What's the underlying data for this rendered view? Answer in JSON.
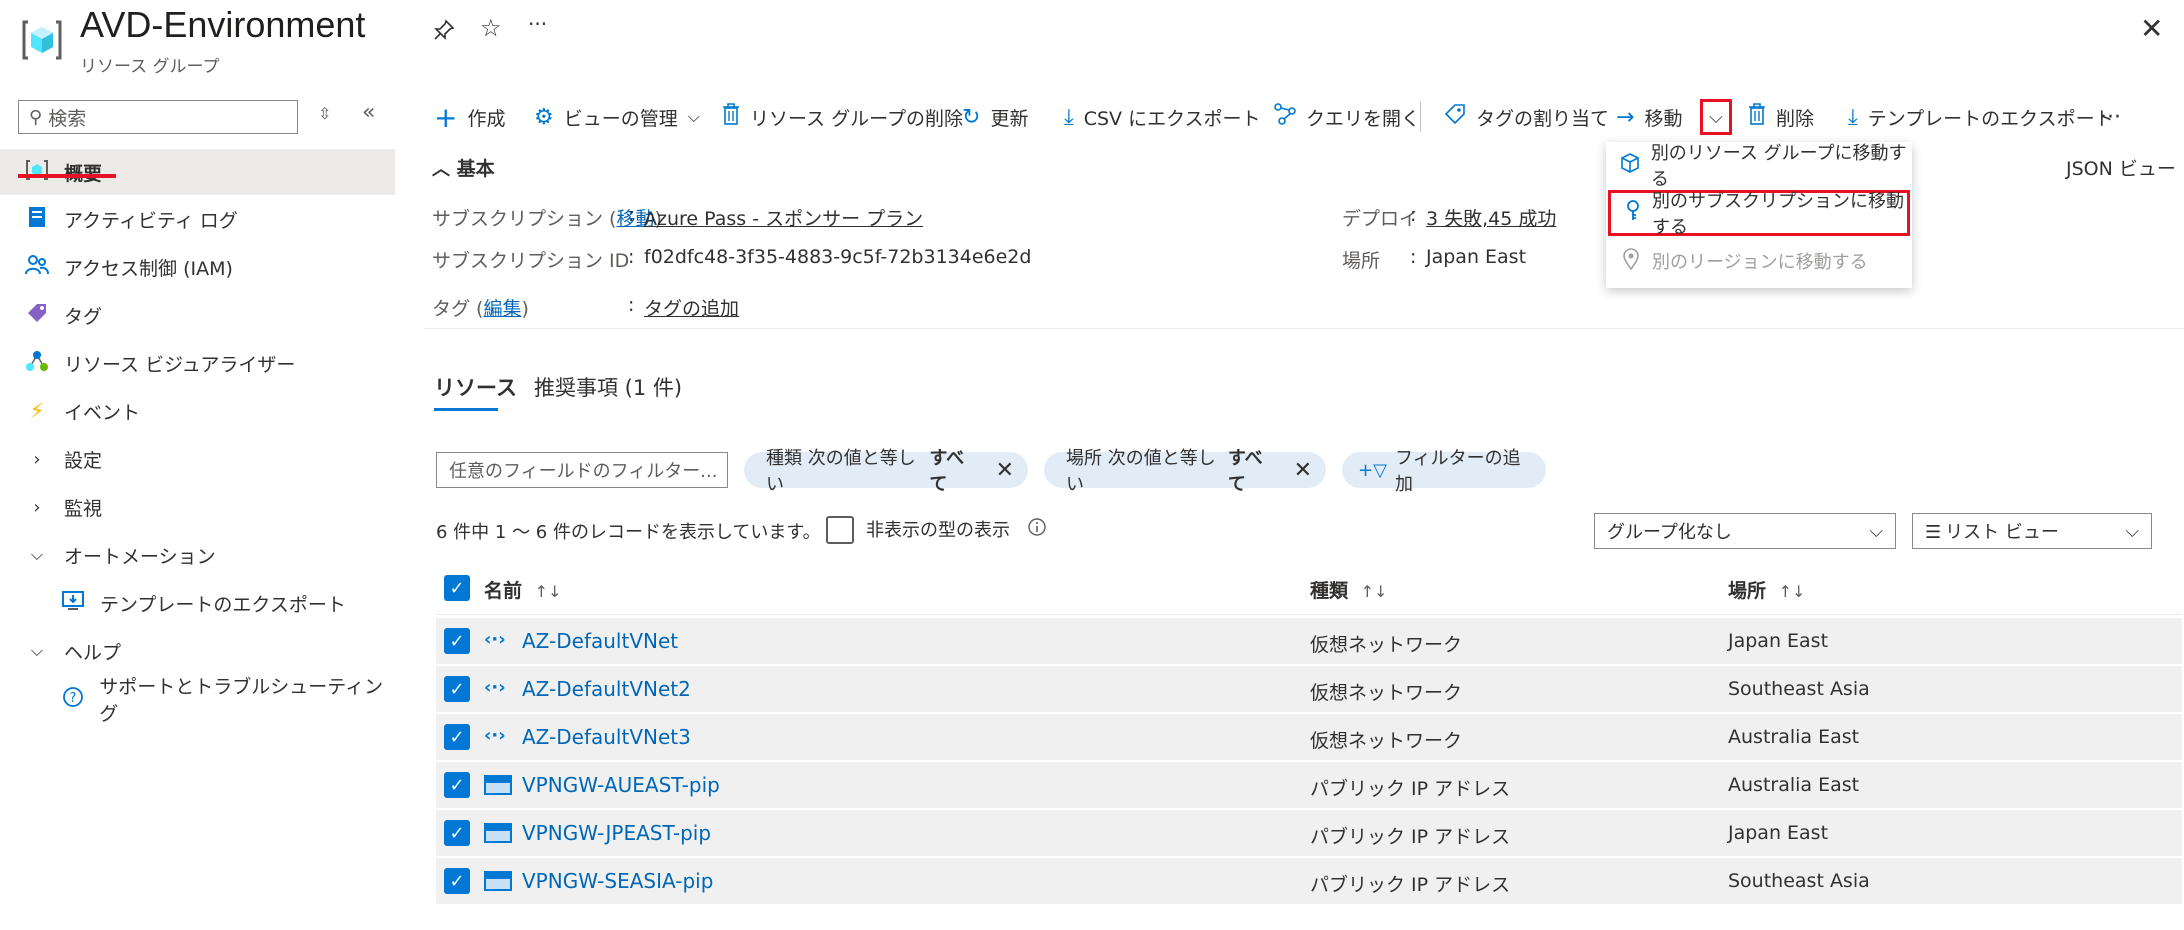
{
  "header": {
    "title": "AVD-Environment",
    "subtitle": "リソース グループ",
    "pin_glyph": "⚲",
    "star_glyph": "☆",
    "more_glyph": "···",
    "close_glyph": "✕"
  },
  "sidebar": {
    "search_placeholder": "検索",
    "items": [
      {
        "label": "概要",
        "icon": "resource-group-icon"
      },
      {
        "label": "アクティビティ ログ",
        "icon": "activity-log-icon"
      },
      {
        "label": "アクセス制御 (IAM)",
        "icon": "people-icon"
      },
      {
        "label": "タグ",
        "icon": "tag-icon"
      },
      {
        "label": "リソース ビジュアライザー",
        "icon": "visualizer-icon"
      },
      {
        "label": "イベント",
        "icon": "lightning-icon"
      },
      {
        "label": "設定",
        "icon": "chevron-right-icon"
      },
      {
        "label": "監視",
        "icon": "chevron-right-icon"
      },
      {
        "label": "オートメーション",
        "icon": "chevron-down-icon"
      },
      {
        "label": "テンプレートのエクスポート",
        "icon": "export-template-icon"
      },
      {
        "label": "ヘルプ",
        "icon": "chevron-down-icon"
      },
      {
        "label": "サポートとトラブルシューティング",
        "icon": "help-circle-icon"
      }
    ]
  },
  "toolbar": {
    "create": "作成",
    "manage_view": "ビューの管理",
    "delete_rg": "リソース グループの削除",
    "refresh": "更新",
    "export_csv": "CSV にエクスポート",
    "open_query": "クエリを開く",
    "assign_tags": "タグの割り当て",
    "move": "移動",
    "delete": "削除",
    "export_template": "テンプレートのエクスポート",
    "more": "···"
  },
  "move_menu": {
    "items": [
      {
        "label": "別のリソース グループに移動する",
        "enabled": true
      },
      {
        "label": "別のサブスクリプションに移動する",
        "enabled": true
      },
      {
        "label": "別のリージョンに移動する",
        "enabled": false
      }
    ]
  },
  "essentials": {
    "header": "基本",
    "json_view": "JSON ビュー",
    "subscription_label_pre": "サブスクリプション (",
    "subscription_label_link": "移動",
    "subscription_label_post": ")",
    "subscription_value": "Azure Pass - スポンサー プラン",
    "subscription_id_label": "サブスクリプション ID",
    "subscription_id_value": "f02dfc48-3f35-4883-9c5f-72b3134e6e2d",
    "tags_label_pre": "タグ (",
    "tags_label_link": "編集",
    "tags_label_post": ")",
    "tags_value": "タグの追加",
    "deploy_label": "デプロイ",
    "deploy_value": "3 失敗,45 成功",
    "location_label": "場所",
    "location_value": "Japan East",
    "colon": ":"
  },
  "tabs": [
    {
      "label": "リソース",
      "active": true
    },
    {
      "label": "推奨事項 (1 件)",
      "active": false
    }
  ],
  "filters": {
    "field_placeholder": "任意のフィールドのフィルター...",
    "type_pill": {
      "label": "種類 次の値と等しい",
      "value": "すべて"
    },
    "location_pill": {
      "label": "場所 次の値と等しい",
      "value": "すべて"
    },
    "add_filter": "フィルターの追加"
  },
  "records": {
    "summary": "6 件中 1 ～ 6 件のレコードを表示しています。",
    "show_hidden": "非表示の型の表示",
    "grouping": "グループ化なし",
    "view": "リスト ビュー"
  },
  "table": {
    "columns": [
      "名前",
      "種類",
      "場所"
    ],
    "sort_glyph": "↑↓",
    "rows": [
      {
        "name": "AZ-DefaultVNet",
        "type": "仮想ネットワーク",
        "location": "Japan East",
        "icon": "vnet"
      },
      {
        "name": "AZ-DefaultVNet2",
        "type": "仮想ネットワーク",
        "location": "Southeast Asia",
        "icon": "vnet"
      },
      {
        "name": "AZ-DefaultVNet3",
        "type": "仮想ネットワーク",
        "location": "Australia East",
        "icon": "vnet"
      },
      {
        "name": "VPNGW-AUEAST-pip",
        "type": "パブリック IP アドレス",
        "location": "Australia East",
        "icon": "pip"
      },
      {
        "name": "VPNGW-JPEAST-pip",
        "type": "パブリック IP アドレス",
        "location": "Japan East",
        "icon": "pip"
      },
      {
        "name": "VPNGW-SEASIA-pip",
        "type": "パブリック IP アドレス",
        "location": "Southeast Asia",
        "icon": "pip"
      }
    ]
  },
  "colors": {
    "accent": "#0078d4",
    "highlight": "#e81123",
    "link": "#0067b8"
  }
}
